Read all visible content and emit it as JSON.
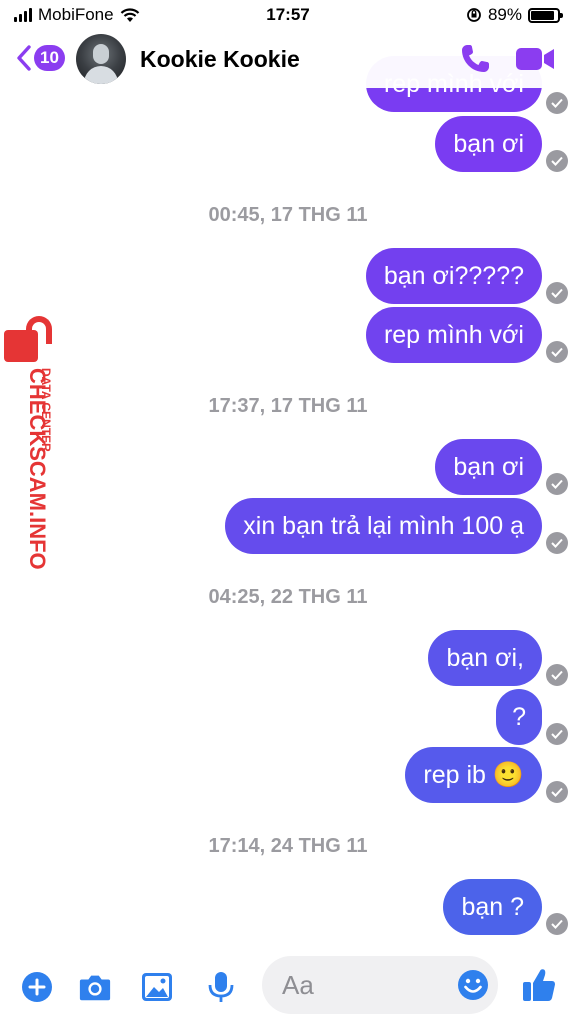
{
  "status_bar": {
    "carrier": "MobiFone",
    "time": "17:57",
    "battery": "89%",
    "battery_level": 0.89
  },
  "header": {
    "unread_count": "10",
    "contact_name": "Kookie Kookie"
  },
  "messages": [
    {
      "text": "rep mình với",
      "color": "#7a3cf2"
    },
    {
      "text": "bạn ơi",
      "color": "#7a3cf2"
    },
    {
      "timestamp": "00:45, 17 THG 11"
    },
    {
      "text": "bạn ơi?????",
      "color": "#7340ef"
    },
    {
      "text": "rep mình với",
      "color": "#7143ef"
    },
    {
      "timestamp": "17:37, 17 THG 11"
    },
    {
      "text": "bạn ơi",
      "color": "#6a48ee"
    },
    {
      "text": "xin bạn trả lại mình 100 ạ",
      "color": "#654ced"
    },
    {
      "timestamp": "04:25, 22 THG 11"
    },
    {
      "text": "bạn ơi,",
      "color": "#5b55ec"
    },
    {
      "text": "?",
      "color": "#5957ec"
    },
    {
      "text": "rep ib 🙂",
      "color": "#565aec"
    },
    {
      "timestamp": "17:14, 24 THG 11"
    },
    {
      "text": "bạn ?",
      "color": "#4c63ea"
    }
  ],
  "watermark": {
    "brand": "CHECKSCAM.INFO",
    "tagline": "DATA CENTER",
    "color": "#e53535"
  },
  "composer": {
    "placeholder": "Aa"
  },
  "colors": {
    "accent": "#8b3df0",
    "toolbar_blue": "#2f80ed",
    "check_gray": "#9a9aa0"
  },
  "icons": {
    "header": [
      "back-chevron-icon",
      "phone-icon",
      "video-camera-icon"
    ],
    "toolbar": [
      "plus-icon",
      "camera-icon",
      "image-icon",
      "microphone-icon",
      "emoji-icon",
      "thumbs-up-icon"
    ]
  }
}
